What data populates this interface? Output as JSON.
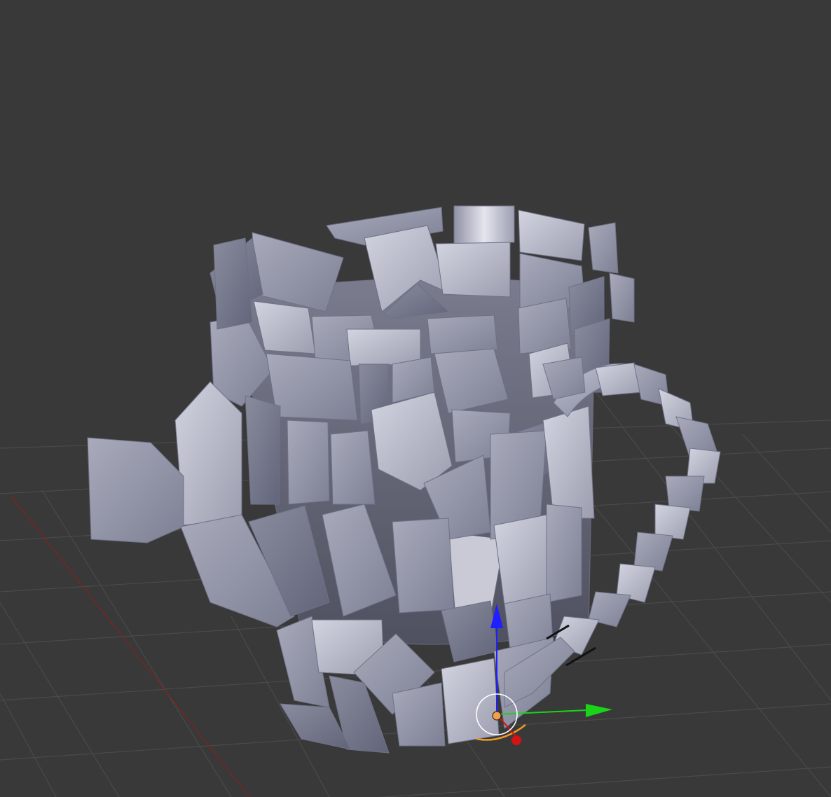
{
  "app": {
    "view": "3d-viewport",
    "object": "shattered-mug"
  },
  "colors": {
    "background": "#393939",
    "grid": "#4a4a4a",
    "x_axis_line": "#7a2424",
    "shard_light": "#c4c6d4",
    "shard_mid": "#9a9cae",
    "shard_dark": "#6f7286",
    "inner_dark": "#5e6070",
    "manipulator_z": "#1f1fff",
    "manipulator_y": "#19d419",
    "manipulator_x": "#d11414",
    "origin": "#f0a050",
    "selection_outline": "#f39a24"
  },
  "icons": {
    "origin_point": "origin-icon",
    "manipulator": "transform-gizmo-icon"
  }
}
